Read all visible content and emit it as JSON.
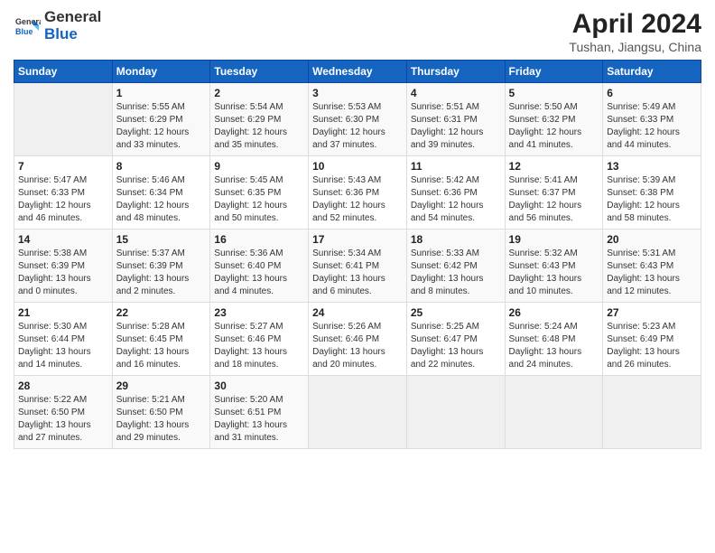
{
  "header": {
    "logo_general": "General",
    "logo_blue": "Blue",
    "month_title": "April 2024",
    "location": "Tushan, Jiangsu, China"
  },
  "days_of_week": [
    "Sunday",
    "Monday",
    "Tuesday",
    "Wednesday",
    "Thursday",
    "Friday",
    "Saturday"
  ],
  "weeks": [
    [
      {
        "day": "",
        "info": ""
      },
      {
        "day": "1",
        "info": "Sunrise: 5:55 AM\nSunset: 6:29 PM\nDaylight: 12 hours\nand 33 minutes."
      },
      {
        "day": "2",
        "info": "Sunrise: 5:54 AM\nSunset: 6:29 PM\nDaylight: 12 hours\nand 35 minutes."
      },
      {
        "day": "3",
        "info": "Sunrise: 5:53 AM\nSunset: 6:30 PM\nDaylight: 12 hours\nand 37 minutes."
      },
      {
        "day": "4",
        "info": "Sunrise: 5:51 AM\nSunset: 6:31 PM\nDaylight: 12 hours\nand 39 minutes."
      },
      {
        "day": "5",
        "info": "Sunrise: 5:50 AM\nSunset: 6:32 PM\nDaylight: 12 hours\nand 41 minutes."
      },
      {
        "day": "6",
        "info": "Sunrise: 5:49 AM\nSunset: 6:33 PM\nDaylight: 12 hours\nand 44 minutes."
      }
    ],
    [
      {
        "day": "7",
        "info": "Sunrise: 5:47 AM\nSunset: 6:33 PM\nDaylight: 12 hours\nand 46 minutes."
      },
      {
        "day": "8",
        "info": "Sunrise: 5:46 AM\nSunset: 6:34 PM\nDaylight: 12 hours\nand 48 minutes."
      },
      {
        "day": "9",
        "info": "Sunrise: 5:45 AM\nSunset: 6:35 PM\nDaylight: 12 hours\nand 50 minutes."
      },
      {
        "day": "10",
        "info": "Sunrise: 5:43 AM\nSunset: 6:36 PM\nDaylight: 12 hours\nand 52 minutes."
      },
      {
        "day": "11",
        "info": "Sunrise: 5:42 AM\nSunset: 6:36 PM\nDaylight: 12 hours\nand 54 minutes."
      },
      {
        "day": "12",
        "info": "Sunrise: 5:41 AM\nSunset: 6:37 PM\nDaylight: 12 hours\nand 56 minutes."
      },
      {
        "day": "13",
        "info": "Sunrise: 5:39 AM\nSunset: 6:38 PM\nDaylight: 12 hours\nand 58 minutes."
      }
    ],
    [
      {
        "day": "14",
        "info": "Sunrise: 5:38 AM\nSunset: 6:39 PM\nDaylight: 13 hours\nand 0 minutes."
      },
      {
        "day": "15",
        "info": "Sunrise: 5:37 AM\nSunset: 6:39 PM\nDaylight: 13 hours\nand 2 minutes."
      },
      {
        "day": "16",
        "info": "Sunrise: 5:36 AM\nSunset: 6:40 PM\nDaylight: 13 hours\nand 4 minutes."
      },
      {
        "day": "17",
        "info": "Sunrise: 5:34 AM\nSunset: 6:41 PM\nDaylight: 13 hours\nand 6 minutes."
      },
      {
        "day": "18",
        "info": "Sunrise: 5:33 AM\nSunset: 6:42 PM\nDaylight: 13 hours\nand 8 minutes."
      },
      {
        "day": "19",
        "info": "Sunrise: 5:32 AM\nSunset: 6:43 PM\nDaylight: 13 hours\nand 10 minutes."
      },
      {
        "day": "20",
        "info": "Sunrise: 5:31 AM\nSunset: 6:43 PM\nDaylight: 13 hours\nand 12 minutes."
      }
    ],
    [
      {
        "day": "21",
        "info": "Sunrise: 5:30 AM\nSunset: 6:44 PM\nDaylight: 13 hours\nand 14 minutes."
      },
      {
        "day": "22",
        "info": "Sunrise: 5:28 AM\nSunset: 6:45 PM\nDaylight: 13 hours\nand 16 minutes."
      },
      {
        "day": "23",
        "info": "Sunrise: 5:27 AM\nSunset: 6:46 PM\nDaylight: 13 hours\nand 18 minutes."
      },
      {
        "day": "24",
        "info": "Sunrise: 5:26 AM\nSunset: 6:46 PM\nDaylight: 13 hours\nand 20 minutes."
      },
      {
        "day": "25",
        "info": "Sunrise: 5:25 AM\nSunset: 6:47 PM\nDaylight: 13 hours\nand 22 minutes."
      },
      {
        "day": "26",
        "info": "Sunrise: 5:24 AM\nSunset: 6:48 PM\nDaylight: 13 hours\nand 24 minutes."
      },
      {
        "day": "27",
        "info": "Sunrise: 5:23 AM\nSunset: 6:49 PM\nDaylight: 13 hours\nand 26 minutes."
      }
    ],
    [
      {
        "day": "28",
        "info": "Sunrise: 5:22 AM\nSunset: 6:50 PM\nDaylight: 13 hours\nand 27 minutes."
      },
      {
        "day": "29",
        "info": "Sunrise: 5:21 AM\nSunset: 6:50 PM\nDaylight: 13 hours\nand 29 minutes."
      },
      {
        "day": "30",
        "info": "Sunrise: 5:20 AM\nSunset: 6:51 PM\nDaylight: 13 hours\nand 31 minutes."
      },
      {
        "day": "",
        "info": ""
      },
      {
        "day": "",
        "info": ""
      },
      {
        "day": "",
        "info": ""
      },
      {
        "day": "",
        "info": ""
      }
    ]
  ]
}
